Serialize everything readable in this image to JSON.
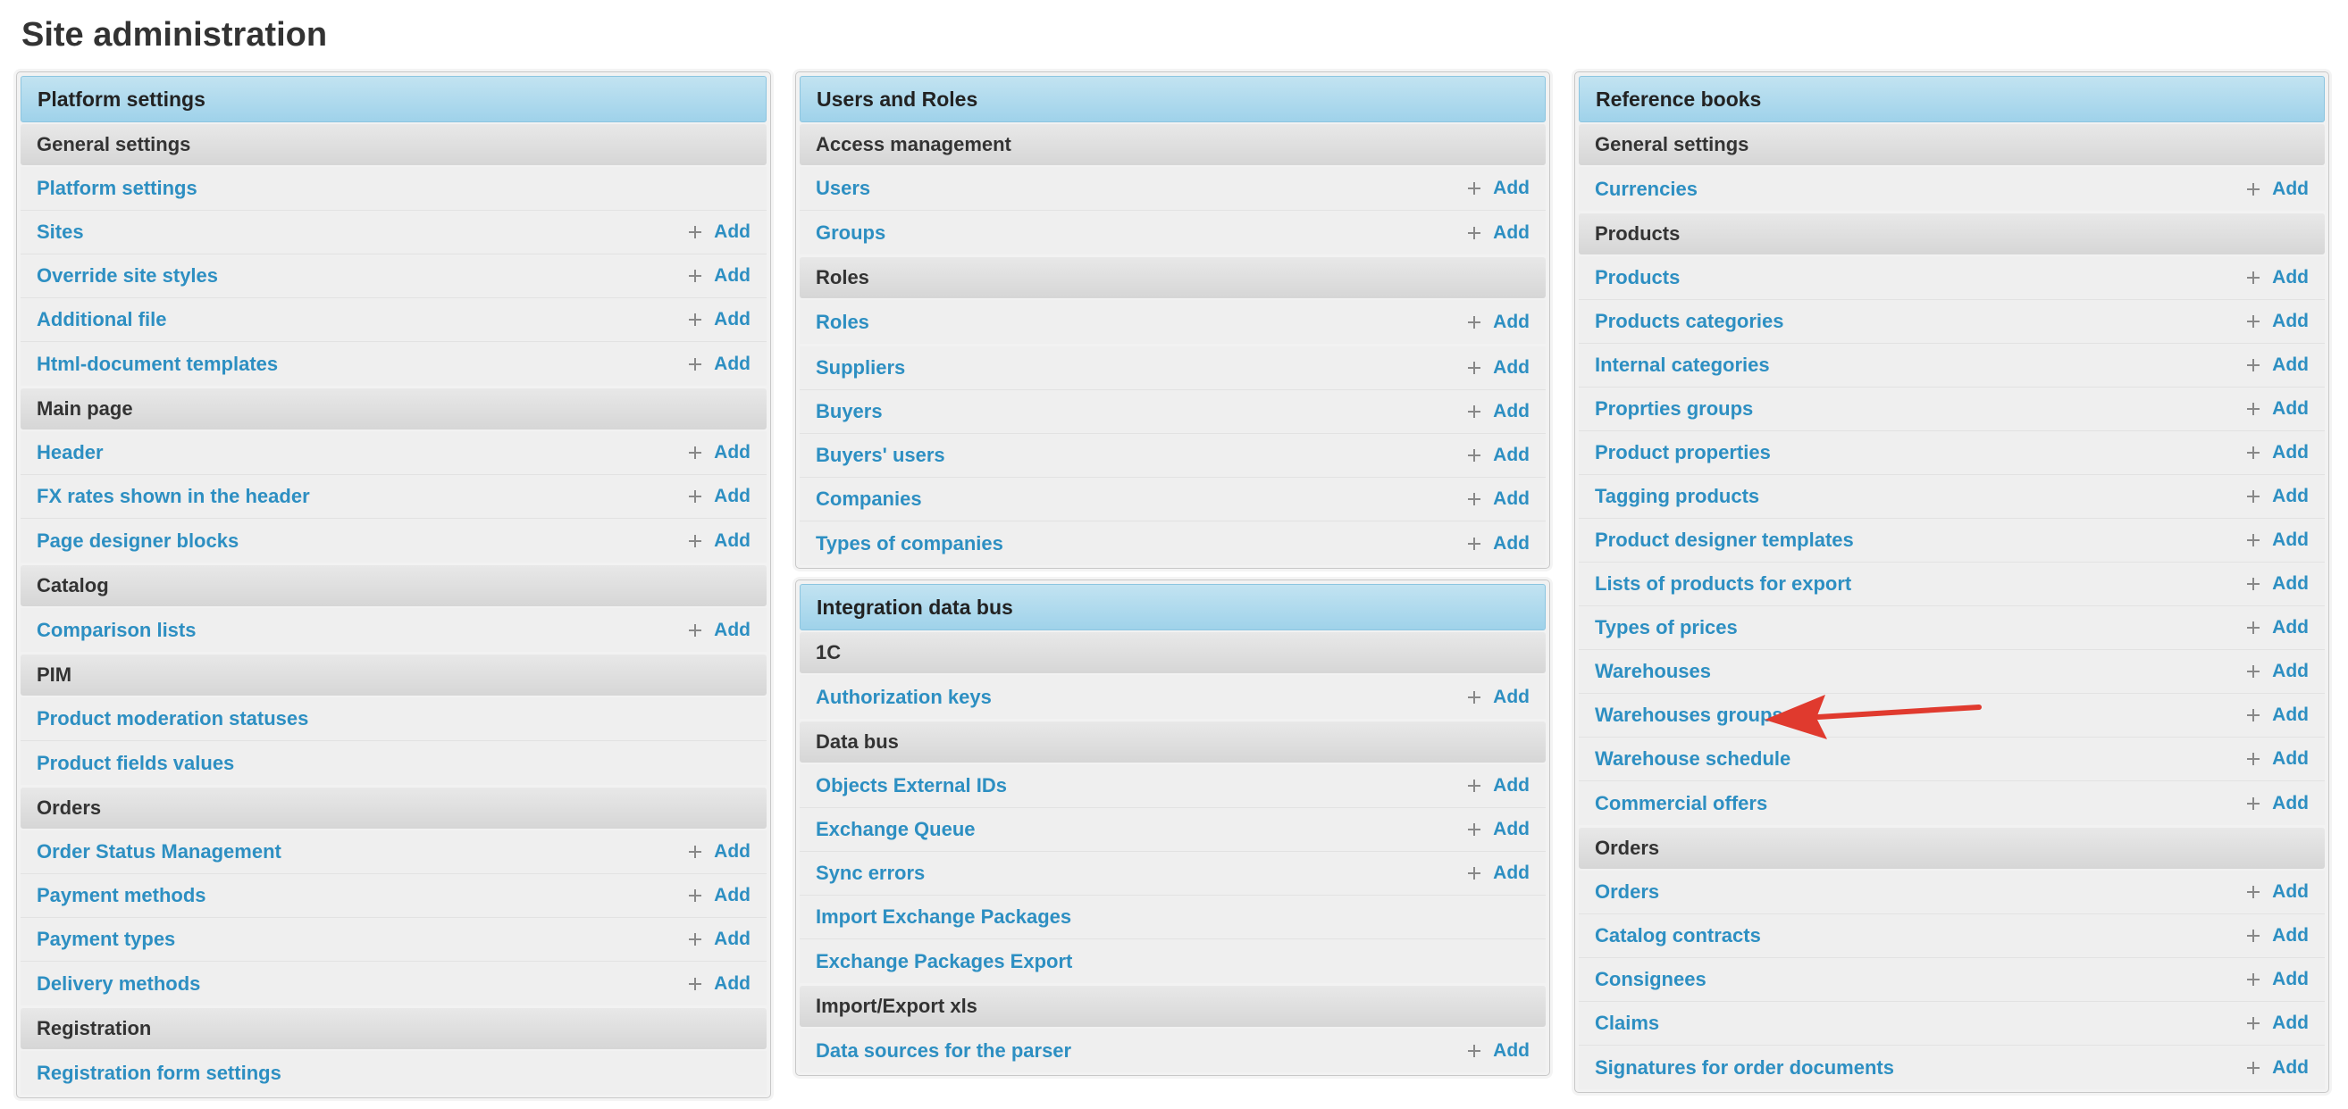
{
  "page": {
    "title": "Site administration"
  },
  "add_label": "Add",
  "columns": [
    {
      "modules": [
        {
          "title": "Platform settings",
          "sections": [
            {
              "title": "General settings",
              "items": [
                {
                  "label": "Platform settings",
                  "add": false
                },
                {
                  "label": "Sites",
                  "add": true
                },
                {
                  "label": "Override site styles",
                  "add": true
                },
                {
                  "label": "Additional file",
                  "add": true
                },
                {
                  "label": "Html-document templates",
                  "add": true
                }
              ]
            },
            {
              "title": "Main page",
              "items": [
                {
                  "label": "Header",
                  "add": true
                },
                {
                  "label": "FX rates shown in the header",
                  "add": true
                },
                {
                  "label": "Page designer blocks",
                  "add": true
                }
              ]
            },
            {
              "title": "Catalog",
              "items": [
                {
                  "label": "Comparison lists",
                  "add": true
                }
              ]
            },
            {
              "title": "PIM",
              "items": [
                {
                  "label": "Product moderation statuses",
                  "add": false
                },
                {
                  "label": "Product fields values",
                  "add": false
                }
              ]
            },
            {
              "title": "Orders",
              "items": [
                {
                  "label": "Order Status Management",
                  "add": true
                },
                {
                  "label": "Payment methods",
                  "add": true
                },
                {
                  "label": "Payment types",
                  "add": true
                },
                {
                  "label": "Delivery methods",
                  "add": true
                }
              ]
            },
            {
              "title": "Registration",
              "items": [
                {
                  "label": "Registration form settings",
                  "add": false
                }
              ]
            }
          ]
        }
      ]
    },
    {
      "modules": [
        {
          "title": "Users and Roles",
          "sections": [
            {
              "title": "Access management",
              "items": [
                {
                  "label": "Users",
                  "add": true
                },
                {
                  "label": "Groups",
                  "add": true
                }
              ]
            },
            {
              "title": "Roles",
              "items": [
                {
                  "label": "Roles",
                  "add": true
                }
              ]
            },
            {
              "title": "",
              "items": [
                {
                  "label": "Suppliers",
                  "add": true
                },
                {
                  "label": "Buyers",
                  "add": true
                },
                {
                  "label": "Buyers' users",
                  "add": true
                },
                {
                  "label": "Companies",
                  "add": true
                },
                {
                  "label": "Types of companies",
                  "add": true
                }
              ]
            }
          ]
        },
        {
          "title": "Integration data bus",
          "sections": [
            {
              "title": "1C",
              "items": [
                {
                  "label": "Authorization keys",
                  "add": true
                }
              ]
            },
            {
              "title": "Data bus",
              "items": [
                {
                  "label": "Objects External IDs",
                  "add": true
                },
                {
                  "label": "Exchange Queue",
                  "add": true
                },
                {
                  "label": "Sync errors",
                  "add": true
                },
                {
                  "label": "Import Exchange Packages",
                  "add": false
                },
                {
                  "label": "Exchange Packages Export",
                  "add": false
                }
              ]
            },
            {
              "title": "Import/Export xls",
              "items": [
                {
                  "label": "Data sources for the parser",
                  "add": true
                }
              ]
            }
          ]
        }
      ]
    },
    {
      "modules": [
        {
          "title": "Reference books",
          "sections": [
            {
              "title": "General settings",
              "items": [
                {
                  "label": "Currencies",
                  "add": true
                }
              ]
            },
            {
              "title": "Products",
              "items": [
                {
                  "label": "Products",
                  "add": true
                },
                {
                  "label": "Products categories",
                  "add": true
                },
                {
                  "label": "Internal categories",
                  "add": true
                },
                {
                  "label": "Proprties groups",
                  "add": true
                },
                {
                  "label": "Product properties",
                  "add": true
                },
                {
                  "label": "Tagging products",
                  "add": true
                },
                {
                  "label": "Product designer templates",
                  "add": true
                },
                {
                  "label": "Lists of products for export",
                  "add": true
                },
                {
                  "label": "Types of prices",
                  "add": true
                },
                {
                  "label": "Warehouses",
                  "add": true
                },
                {
                  "label": "Warehouses groups",
                  "add": true
                },
                {
                  "label": "Warehouse schedule",
                  "add": true
                },
                {
                  "label": "Commercial offers",
                  "add": true
                }
              ]
            },
            {
              "title": "Orders",
              "items": [
                {
                  "label": "Orders",
                  "add": true
                },
                {
                  "label": "Catalog contracts",
                  "add": true
                },
                {
                  "label": "Consignees",
                  "add": true
                },
                {
                  "label": "Claims",
                  "add": true
                },
                {
                  "label": "Signatures for order documents",
                  "add": true
                }
              ]
            }
          ]
        }
      ]
    }
  ],
  "annotation": {
    "arrow_color": "#e03a2e",
    "icon": "arrow-left-icon"
  }
}
